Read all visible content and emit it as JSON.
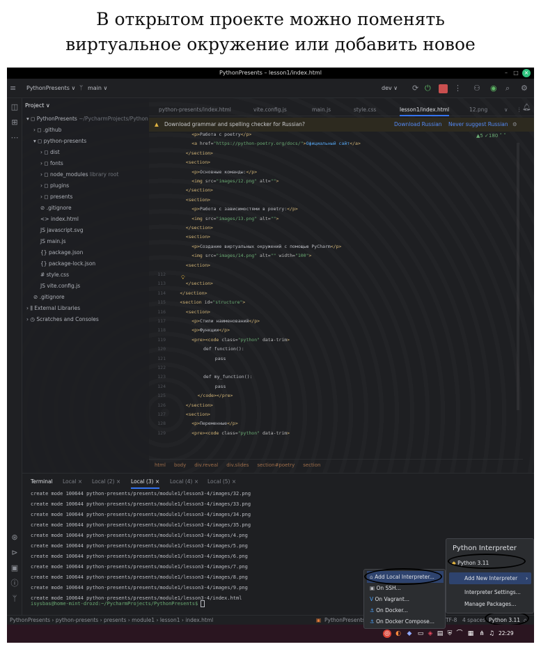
{
  "caption": {
    "line1": "В открытом проекте можно поменять",
    "line2": "виртуальное окружение или добавить новое"
  },
  "window": {
    "title": "PythonPresents – lesson1/index.html",
    "minimize": "–",
    "maximize": "□",
    "close": "×"
  },
  "mainbar": {
    "project": "PythonPresents ∨",
    "branch": "main ∨",
    "run_config": "dev ∨"
  },
  "project_panel": {
    "title": "Project ∨",
    "items": [
      {
        "indent": 0,
        "icon": "▾ ◻",
        "label": "PythonPresents",
        "dim": " ~/PycharmProjects/Python"
      },
      {
        "indent": 1,
        "icon": "› ◻",
        "label": ".github",
        "dim": ""
      },
      {
        "indent": 1,
        "icon": "▾ ◻",
        "label": "python-presents",
        "dim": ""
      },
      {
        "indent": 2,
        "icon": "› ◻",
        "label": "dist",
        "dim": ""
      },
      {
        "indent": 2,
        "icon": "› ◻",
        "label": "fonts",
        "dim": ""
      },
      {
        "indent": 2,
        "icon": "› ◻",
        "label": "node_modules",
        "dim": " library root"
      },
      {
        "indent": 2,
        "icon": "› ◻",
        "label": "plugins",
        "dim": ""
      },
      {
        "indent": 2,
        "icon": "› ◻",
        "label": "presents",
        "dim": ""
      },
      {
        "indent": 2,
        "icon": "⊘",
        "label": ".gitignore",
        "dim": ""
      },
      {
        "indent": 2,
        "icon": "<>",
        "label": "index.html",
        "dim": ""
      },
      {
        "indent": 2,
        "icon": "JS",
        "label": "javascript.svg",
        "dim": ""
      },
      {
        "indent": 2,
        "icon": "JS",
        "label": "main.js",
        "dim": ""
      },
      {
        "indent": 2,
        "icon": "{}",
        "label": "package.json",
        "dim": ""
      },
      {
        "indent": 2,
        "icon": "{}",
        "label": "package-lock.json",
        "dim": ""
      },
      {
        "indent": 2,
        "icon": "#",
        "label": "style.css",
        "dim": ""
      },
      {
        "indent": 2,
        "icon": "JS",
        "label": "vite.config.js",
        "dim": ""
      },
      {
        "indent": 1,
        "icon": "⊘",
        "label": ".gitignore",
        "dim": ""
      },
      {
        "indent": 0,
        "icon": "› ⫼",
        "label": "External Libraries",
        "dim": ""
      },
      {
        "indent": 0,
        "icon": "› ◷",
        "label": "Scratches and Consoles",
        "dim": ""
      }
    ]
  },
  "tabs": [
    "python-presents/index.html",
    "vite.config.js",
    "main.js",
    "style.css",
    "lesson1/index.html",
    "12.png"
  ],
  "banner": {
    "text": "Download grammar and spelling checker for Russian?",
    "download": "Download Russian",
    "never": "Never suggest Russian"
  },
  "inspections": "▲5 ✓180 ˄ ˅",
  "editor": {
    "lines": [
      {
        "n": "",
        "ind": 6,
        "p": [
          [
            "tg",
            "<p>"
          ],
          [
            "",
            "Работа с poetry"
          ],
          [
            "tg",
            "</p>"
          ]
        ]
      },
      {
        "n": "",
        "ind": 6,
        "p": [
          [
            "tg",
            "<a "
          ],
          [
            "at",
            "href="
          ],
          [
            "st",
            "\"https://python-poetry.org/docs/\""
          ],
          [
            "tg",
            ">"
          ],
          [
            "lk",
            "Официальный сайт"
          ],
          [
            "tg",
            "</a>"
          ]
        ]
      },
      {
        "n": "",
        "ind": 4,
        "p": [
          [
            "tg",
            "</section>"
          ]
        ]
      },
      {
        "n": "",
        "ind": 4,
        "p": [
          [
            "tg",
            "<section>"
          ]
        ]
      },
      {
        "n": "",
        "ind": 6,
        "p": [
          [
            "tg",
            "<p>"
          ],
          [
            "",
            "Основные команды:"
          ],
          [
            "tg",
            "</p>"
          ]
        ]
      },
      {
        "n": "",
        "ind": 6,
        "p": [
          [
            "tg",
            "<img "
          ],
          [
            "at",
            "src="
          ],
          [
            "st",
            "\"images/12.png\""
          ],
          [
            "at",
            " alt="
          ],
          [
            "st",
            "\"\""
          ],
          [
            "tg",
            ">"
          ]
        ]
      },
      {
        "n": "",
        "ind": 4,
        "p": [
          [
            "tg",
            "</section>"
          ]
        ]
      },
      {
        "n": "",
        "ind": 4,
        "p": [
          [
            "tg",
            "<section>"
          ]
        ]
      },
      {
        "n": "",
        "ind": 6,
        "p": [
          [
            "tg",
            "<p>"
          ],
          [
            "",
            "Работа с зависимостями в poetry:"
          ],
          [
            "tg",
            "</p>"
          ]
        ]
      },
      {
        "n": "",
        "ind": 6,
        "p": [
          [
            "tg",
            "<img "
          ],
          [
            "at",
            "src="
          ],
          [
            "st",
            "\"images/13.png\""
          ],
          [
            "at",
            " alt="
          ],
          [
            "st",
            "\"\""
          ],
          [
            "tg",
            ">"
          ]
        ]
      },
      {
        "n": "",
        "ind": 4,
        "p": [
          [
            "tg",
            "</section>"
          ]
        ]
      },
      {
        "n": "",
        "ind": 4,
        "p": [
          [
            "tg",
            "<section>"
          ]
        ]
      },
      {
        "n": "",
        "ind": 6,
        "p": [
          [
            "tg",
            "<p>"
          ],
          [
            "",
            "Создание виртуальных окружений с помощью PyCharm"
          ],
          [
            "tg",
            "</p>"
          ]
        ]
      },
      {
        "n": "",
        "ind": 6,
        "p": [
          [
            "tg",
            "<img "
          ],
          [
            "at",
            "src="
          ],
          [
            "st",
            "\"images/14.png\""
          ],
          [
            "at",
            " alt="
          ],
          [
            "st",
            "\"\""
          ],
          [
            "at",
            " width="
          ],
          [
            "st",
            "\"100\""
          ],
          [
            "tg",
            ">"
          ]
        ]
      },
      {
        "n": "",
        "ind": 4,
        "p": [
          [
            "tg",
            "<section>"
          ]
        ]
      },
      {
        "n": "112",
        "ind": 0,
        "p": []
      },
      {
        "n": "113",
        "ind": 4,
        "p": [
          [
            "tg",
            "</section>"
          ]
        ]
      },
      {
        "n": "114",
        "ind": 2,
        "p": [
          [
            "tg",
            "</section>"
          ]
        ]
      },
      {
        "n": "115",
        "ind": 2,
        "p": [
          [
            "tg",
            "<section "
          ],
          [
            "at",
            "id="
          ],
          [
            "st",
            "\"structure\""
          ],
          [
            "tg",
            ">"
          ]
        ]
      },
      {
        "n": "116",
        "ind": 4,
        "p": [
          [
            "tg",
            "<section>"
          ]
        ]
      },
      {
        "n": "117",
        "ind": 6,
        "p": [
          [
            "tg",
            "<p>"
          ],
          [
            "",
            "Стили наименований"
          ],
          [
            "tg",
            "</p>"
          ]
        ]
      },
      {
        "n": "118",
        "ind": 6,
        "p": [
          [
            "tg",
            "<p>"
          ],
          [
            "",
            "Функции"
          ],
          [
            "tg",
            "</p>"
          ]
        ]
      },
      {
        "n": "119",
        "ind": 6,
        "p": [
          [
            "tg",
            "<pre><code "
          ],
          [
            "at",
            "class="
          ],
          [
            "st",
            "\"python\""
          ],
          [
            "at",
            " data-trim"
          ],
          [
            "tg",
            ">"
          ]
        ]
      },
      {
        "n": "120",
        "ind": 10,
        "p": [
          [
            "",
            "def function():"
          ]
        ]
      },
      {
        "n": "121",
        "ind": 14,
        "p": [
          [
            "",
            "pass"
          ]
        ]
      },
      {
        "n": "122",
        "ind": 0,
        "p": []
      },
      {
        "n": "123",
        "ind": 10,
        "p": [
          [
            "",
            "def my_function():"
          ]
        ]
      },
      {
        "n": "124",
        "ind": 14,
        "p": [
          [
            "",
            "pass"
          ]
        ]
      },
      {
        "n": "125",
        "ind": 8,
        "p": [
          [
            "tg",
            "</code></pre>"
          ]
        ]
      },
      {
        "n": "126",
        "ind": 4,
        "p": [
          [
            "tg",
            "</section>"
          ]
        ]
      },
      {
        "n": "127",
        "ind": 4,
        "p": [
          [
            "tg",
            "<section>"
          ]
        ]
      },
      {
        "n": "128",
        "ind": 6,
        "p": [
          [
            "tg",
            "<p>"
          ],
          [
            "",
            "Переменные"
          ],
          [
            "tg",
            "</p>"
          ]
        ]
      },
      {
        "n": "129",
        "ind": 6,
        "p": [
          [
            "tg",
            "<pre><code "
          ],
          [
            "at",
            "class="
          ],
          [
            "st",
            "\"python\""
          ],
          [
            "at",
            " data-trim"
          ],
          [
            "tg",
            ">"
          ]
        ]
      }
    ]
  },
  "breadcrumbs": [
    "html",
    "body",
    "div.reveal",
    "div.slides",
    "section#poetry",
    "section"
  ],
  "terminal": {
    "tabs": [
      "Terminal",
      "Local ×",
      "Local (2) ×",
      "Local (3) ×",
      "Local (4) ×",
      "Local (5) ×"
    ],
    "lines": [
      "create mode 100644 python-presents/presents/module1/lesson3-4/images/32.png",
      "create mode 100644 python-presents/presents/module1/lesson3-4/images/33.png",
      "create mode 100644 python-presents/presents/module1/lesson3-4/images/34.png",
      "create mode 100644 python-presents/presents/module1/lesson3-4/images/35.png",
      "create mode 100644 python-presents/presents/module1/lesson3-4/images/4.png",
      "create mode 100644 python-presents/presents/module1/lesson3-4/images/5.png",
      "create mode 100644 python-presents/presents/module1/lesson3-4/images/6.png",
      "create mode 100644 python-presents/presents/module1/lesson3-4/images/7.png",
      "create mode 100644 python-presents/presents/module1/lesson3-4/images/8.png",
      "create mode 100644 python-presents/presents/module1/lesson3-4/images/9.png",
      "create mode 100644 python-presents/presents/module1/lesson3-4/index.html"
    ],
    "prompt": "isysbas@home-mint-drozd:~/PycharmProjects/PythonPresents$ "
  },
  "status": {
    "path": [
      "PythonPresents",
      "python-presents",
      "presents",
      "module1",
      "lesson1",
      "index.html"
    ],
    "plugin": "PythonPresents",
    "encoding": "TF-8",
    "indent": "4 spaces",
    "interpreter": "Python 3.11"
  },
  "interpreter_menu": {
    "title": "Python Interpreter",
    "current": "Python 3.11",
    "add_new": "Add New Interpreter",
    "settings": "Interpreter Settings...",
    "manage": "Manage Packages..."
  },
  "add_submenu": [
    "Add Local Interpreter...",
    "On SSH...",
    "On Vagrant...",
    "On Docker...",
    "On Docker Compose..."
  ],
  "taskbar": {
    "time": "22:29"
  },
  "colors": {
    "bg": "#1e1f22",
    "accent": "#3574f0",
    "tag": "#d5b778",
    "string": "#6aab73"
  }
}
